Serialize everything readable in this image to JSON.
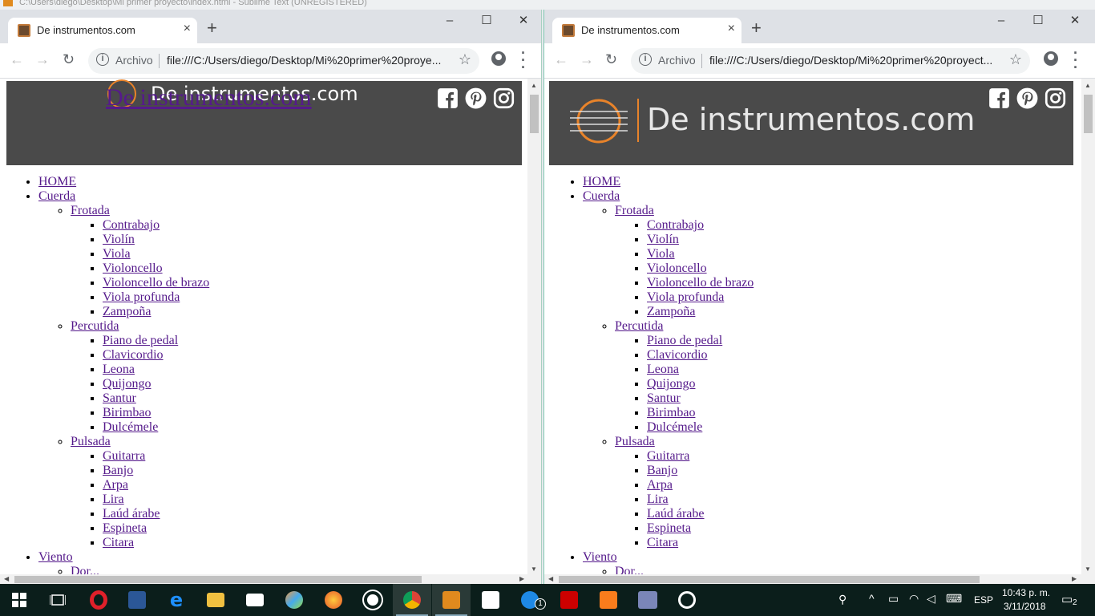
{
  "background_window": {
    "title": "C:\\Users\\diego\\Desktop\\Mi primer proyecto\\index.html - Sublime Text (UNREGISTERED)"
  },
  "browser": {
    "tab_title": "De instrumentos.com",
    "new_tab": "+",
    "tab_close": "×",
    "scheme_label": "Archivo",
    "url_left": "file:///C:/Users/diego/Desktop/Mi%20primer%20proye...",
    "url_right": "file:///C:/Users/diego/Desktop/Mi%20primer%20proyect...",
    "minimize": "–",
    "maximize": "☐",
    "close": "✕"
  },
  "site": {
    "logo_text": "De instrumentos.com",
    "logo_dot_color": "#e8832a",
    "social_icons": [
      "facebook-icon",
      "pinterest-icon",
      "instagram-icon"
    ]
  },
  "nav": {
    "home": "HOME",
    "cuerda": "Cuerda",
    "frotada": "Frotada",
    "frotada_items": [
      "Contrabajo",
      "Violín",
      "Viola",
      "Violoncello",
      "Violoncello de brazo",
      "Viola profunda",
      "Zampoña"
    ],
    "percutida": "Percutida",
    "percutida_items": [
      "Piano de pedal",
      "Clavicordio",
      "Leona",
      "Quijongo",
      "Santur",
      "Birimbao",
      "Dulcémele"
    ],
    "pulsada": "Pulsada",
    "pulsada_items": [
      "Guitarra",
      "Banjo",
      "Arpa",
      "Lira",
      "Laúd árabe",
      "Espineta",
      "Citara"
    ],
    "viento": "Viento",
    "partial_item": "Dor..."
  },
  "taskbar": {
    "apps": [
      "windows-start-icon",
      "task-view-icon",
      "opera-icon",
      "word-icon",
      "edge-icon",
      "file-explorer-icon",
      "mail-icon",
      "paint-icon",
      "firefox-icon",
      "whatsapp-icon",
      "chrome-icon",
      "sublime-text-icon",
      "tool-icon",
      "messenger-icon",
      "acrobat-icon",
      "xampp-icon",
      "php-icon",
      "groove-icon"
    ],
    "messenger_badge": "1",
    "language": "ESP",
    "time": "10:43 p. m.",
    "date": "3/11/2018",
    "notifications": "2"
  }
}
